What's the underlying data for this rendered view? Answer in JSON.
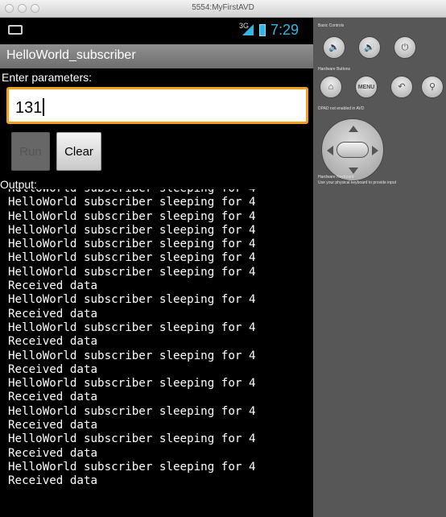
{
  "window": {
    "title": "5554:MyFirstAVD"
  },
  "statusbar": {
    "network": "3G",
    "time": "7:29"
  },
  "app": {
    "title": "HelloWorld_subscriber",
    "params_label": "Enter parameters:",
    "params_value": "131",
    "run_label": "Run",
    "clear_label": "Clear",
    "output_label": "Output:",
    "output_lines": [
      "HelloWorld subscriber sleeping for 4",
      "HelloWorld subscriber sleeping for 4",
      "HelloWorld subscriber sleeping for 4",
      "HelloWorld subscriber sleeping for 4",
      "HelloWorld subscriber sleeping for 4",
      "HelloWorld subscriber sleeping for 4",
      "HelloWorld subscriber sleeping for 4",
      "Received data",
      "HelloWorld subscriber sleeping for 4",
      "Received data",
      "HelloWorld subscriber sleeping for 4",
      "Received data",
      "HelloWorld subscriber sleeping for 4",
      "Received data",
      "HelloWorld subscriber sleeping for 4",
      "Received data",
      "HelloWorld subscriber sleeping for 4",
      "Received data",
      "HelloWorld subscriber sleeping for 4",
      "Received data",
      "HelloWorld subscriber sleeping for 4",
      "Received data"
    ]
  },
  "panel": {
    "basic_controls": "Basic Controls",
    "hardware_buttons": "Hardware Buttons",
    "dpad_note": "DPAD not enabled in AVD",
    "keyboard_title": "Hardware Keyboard",
    "keyboard_note": "Use your physical keyboard to provide input",
    "menu_label": "MENU"
  },
  "colors": {
    "accent": "#33b5e5",
    "focus": "#f3a01a",
    "panel": "#575757"
  }
}
